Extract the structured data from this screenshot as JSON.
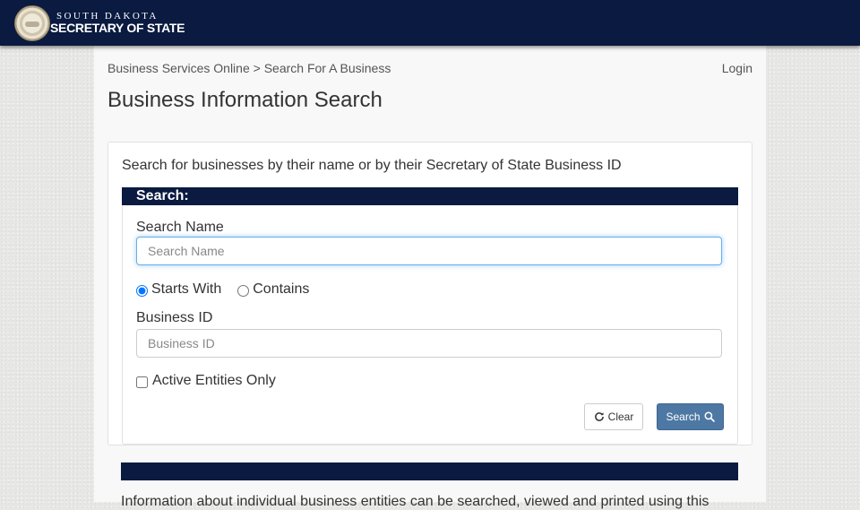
{
  "header": {
    "brand_top": "SOUTH DAKOTA",
    "brand_bottom": "SECRETARY OF STATE",
    "bg_color": "#0a1a40"
  },
  "breadcrumb": {
    "root": "Business Services Online",
    "separator": ">",
    "current": "Search For A Business"
  },
  "nav": {
    "login": "Login"
  },
  "page": {
    "title": "Business Information Search"
  },
  "panel": {
    "intro": "Search for businesses by their name or by their Secretary of State Business ID",
    "bar_label": "Search:"
  },
  "form": {
    "name_label": "Search Name",
    "name_placeholder": "Search Name",
    "name_value": "",
    "radio_starts_with": "Starts With",
    "radio_contains": "Contains",
    "selected_mode": "Starts With",
    "id_label": "Business ID",
    "id_placeholder": "Business ID",
    "id_value": "",
    "active_only_label": "Active Entities Only",
    "active_only_checked": false,
    "clear_label": "Clear",
    "search_label": "Search",
    "clear_icon": "refresh-icon",
    "search_icon": "search-icon",
    "accent_color": "#4d78a3"
  },
  "footer": {
    "text": "Information about individual business entities can be searched, viewed and printed using this"
  }
}
